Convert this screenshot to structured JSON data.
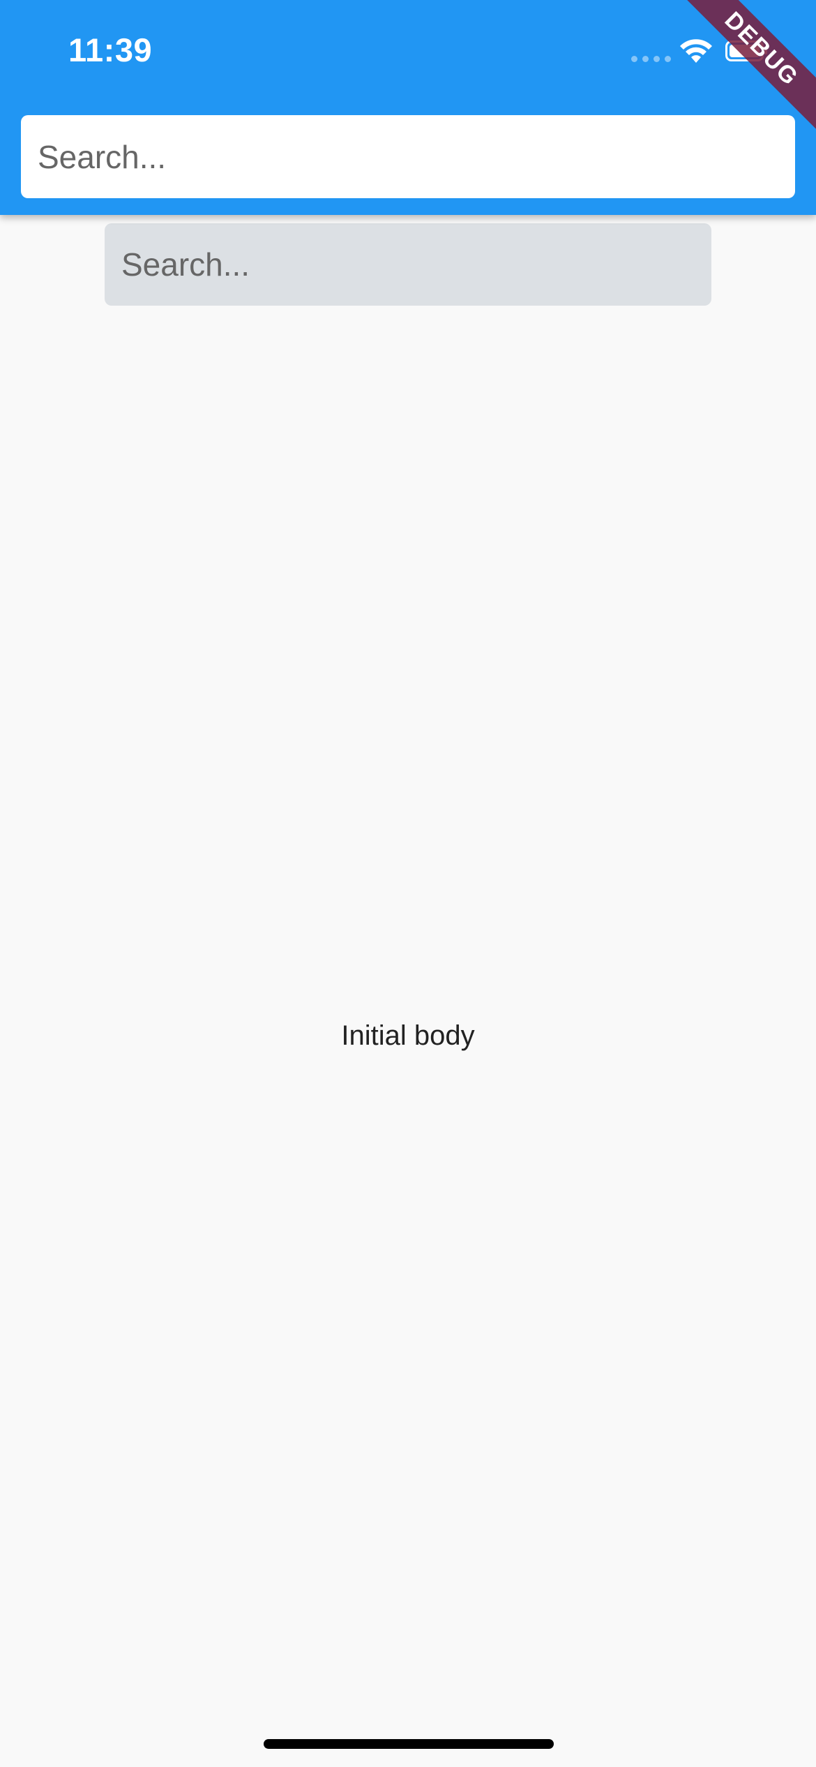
{
  "status_bar": {
    "time": "11:39"
  },
  "app_bar": {
    "search": {
      "placeholder": "Search...",
      "value": ""
    }
  },
  "body": {
    "search": {
      "placeholder": "Search...",
      "value": ""
    },
    "text": "Initial body"
  },
  "debug_banner": {
    "label": "DEBUG"
  },
  "colors": {
    "app_bar": "#2196f3",
    "background": "#f9f9f9",
    "body_search_fill": "#dce0e4",
    "debug_banner": "#781e3c"
  },
  "icons": {
    "wifi": "wifi-icon",
    "battery": "battery-icon",
    "signal": "signal-dots-icon"
  }
}
